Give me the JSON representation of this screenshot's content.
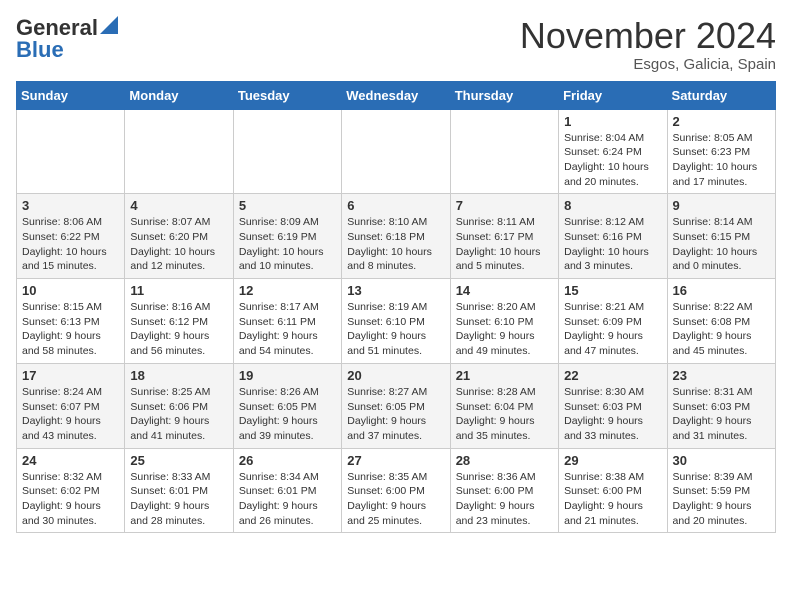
{
  "header": {
    "logo_general": "General",
    "logo_blue": "Blue",
    "month_title": "November 2024",
    "location": "Esgos, Galicia, Spain"
  },
  "weekdays": [
    "Sunday",
    "Monday",
    "Tuesday",
    "Wednesday",
    "Thursday",
    "Friday",
    "Saturday"
  ],
  "weeks": [
    [
      {
        "day": "",
        "info": ""
      },
      {
        "day": "",
        "info": ""
      },
      {
        "day": "",
        "info": ""
      },
      {
        "day": "",
        "info": ""
      },
      {
        "day": "",
        "info": ""
      },
      {
        "day": "1",
        "info": "Sunrise: 8:04 AM\nSunset: 6:24 PM\nDaylight: 10 hours and 20 minutes."
      },
      {
        "day": "2",
        "info": "Sunrise: 8:05 AM\nSunset: 6:23 PM\nDaylight: 10 hours and 17 minutes."
      }
    ],
    [
      {
        "day": "3",
        "info": "Sunrise: 8:06 AM\nSunset: 6:22 PM\nDaylight: 10 hours and 15 minutes."
      },
      {
        "day": "4",
        "info": "Sunrise: 8:07 AM\nSunset: 6:20 PM\nDaylight: 10 hours and 12 minutes."
      },
      {
        "day": "5",
        "info": "Sunrise: 8:09 AM\nSunset: 6:19 PM\nDaylight: 10 hours and 10 minutes."
      },
      {
        "day": "6",
        "info": "Sunrise: 8:10 AM\nSunset: 6:18 PM\nDaylight: 10 hours and 8 minutes."
      },
      {
        "day": "7",
        "info": "Sunrise: 8:11 AM\nSunset: 6:17 PM\nDaylight: 10 hours and 5 minutes."
      },
      {
        "day": "8",
        "info": "Sunrise: 8:12 AM\nSunset: 6:16 PM\nDaylight: 10 hours and 3 minutes."
      },
      {
        "day": "9",
        "info": "Sunrise: 8:14 AM\nSunset: 6:15 PM\nDaylight: 10 hours and 0 minutes."
      }
    ],
    [
      {
        "day": "10",
        "info": "Sunrise: 8:15 AM\nSunset: 6:13 PM\nDaylight: 9 hours and 58 minutes."
      },
      {
        "day": "11",
        "info": "Sunrise: 8:16 AM\nSunset: 6:12 PM\nDaylight: 9 hours and 56 minutes."
      },
      {
        "day": "12",
        "info": "Sunrise: 8:17 AM\nSunset: 6:11 PM\nDaylight: 9 hours and 54 minutes."
      },
      {
        "day": "13",
        "info": "Sunrise: 8:19 AM\nSunset: 6:10 PM\nDaylight: 9 hours and 51 minutes."
      },
      {
        "day": "14",
        "info": "Sunrise: 8:20 AM\nSunset: 6:10 PM\nDaylight: 9 hours and 49 minutes."
      },
      {
        "day": "15",
        "info": "Sunrise: 8:21 AM\nSunset: 6:09 PM\nDaylight: 9 hours and 47 minutes."
      },
      {
        "day": "16",
        "info": "Sunrise: 8:22 AM\nSunset: 6:08 PM\nDaylight: 9 hours and 45 minutes."
      }
    ],
    [
      {
        "day": "17",
        "info": "Sunrise: 8:24 AM\nSunset: 6:07 PM\nDaylight: 9 hours and 43 minutes."
      },
      {
        "day": "18",
        "info": "Sunrise: 8:25 AM\nSunset: 6:06 PM\nDaylight: 9 hours and 41 minutes."
      },
      {
        "day": "19",
        "info": "Sunrise: 8:26 AM\nSunset: 6:05 PM\nDaylight: 9 hours and 39 minutes."
      },
      {
        "day": "20",
        "info": "Sunrise: 8:27 AM\nSunset: 6:05 PM\nDaylight: 9 hours and 37 minutes."
      },
      {
        "day": "21",
        "info": "Sunrise: 8:28 AM\nSunset: 6:04 PM\nDaylight: 9 hours and 35 minutes."
      },
      {
        "day": "22",
        "info": "Sunrise: 8:30 AM\nSunset: 6:03 PM\nDaylight: 9 hours and 33 minutes."
      },
      {
        "day": "23",
        "info": "Sunrise: 8:31 AM\nSunset: 6:03 PM\nDaylight: 9 hours and 31 minutes."
      }
    ],
    [
      {
        "day": "24",
        "info": "Sunrise: 8:32 AM\nSunset: 6:02 PM\nDaylight: 9 hours and 30 minutes."
      },
      {
        "day": "25",
        "info": "Sunrise: 8:33 AM\nSunset: 6:01 PM\nDaylight: 9 hours and 28 minutes."
      },
      {
        "day": "26",
        "info": "Sunrise: 8:34 AM\nSunset: 6:01 PM\nDaylight: 9 hours and 26 minutes."
      },
      {
        "day": "27",
        "info": "Sunrise: 8:35 AM\nSunset: 6:00 PM\nDaylight: 9 hours and 25 minutes."
      },
      {
        "day": "28",
        "info": "Sunrise: 8:36 AM\nSunset: 6:00 PM\nDaylight: 9 hours and 23 minutes."
      },
      {
        "day": "29",
        "info": "Sunrise: 8:38 AM\nSunset: 6:00 PM\nDaylight: 9 hours and 21 minutes."
      },
      {
        "day": "30",
        "info": "Sunrise: 8:39 AM\nSunset: 5:59 PM\nDaylight: 9 hours and 20 minutes."
      }
    ]
  ]
}
